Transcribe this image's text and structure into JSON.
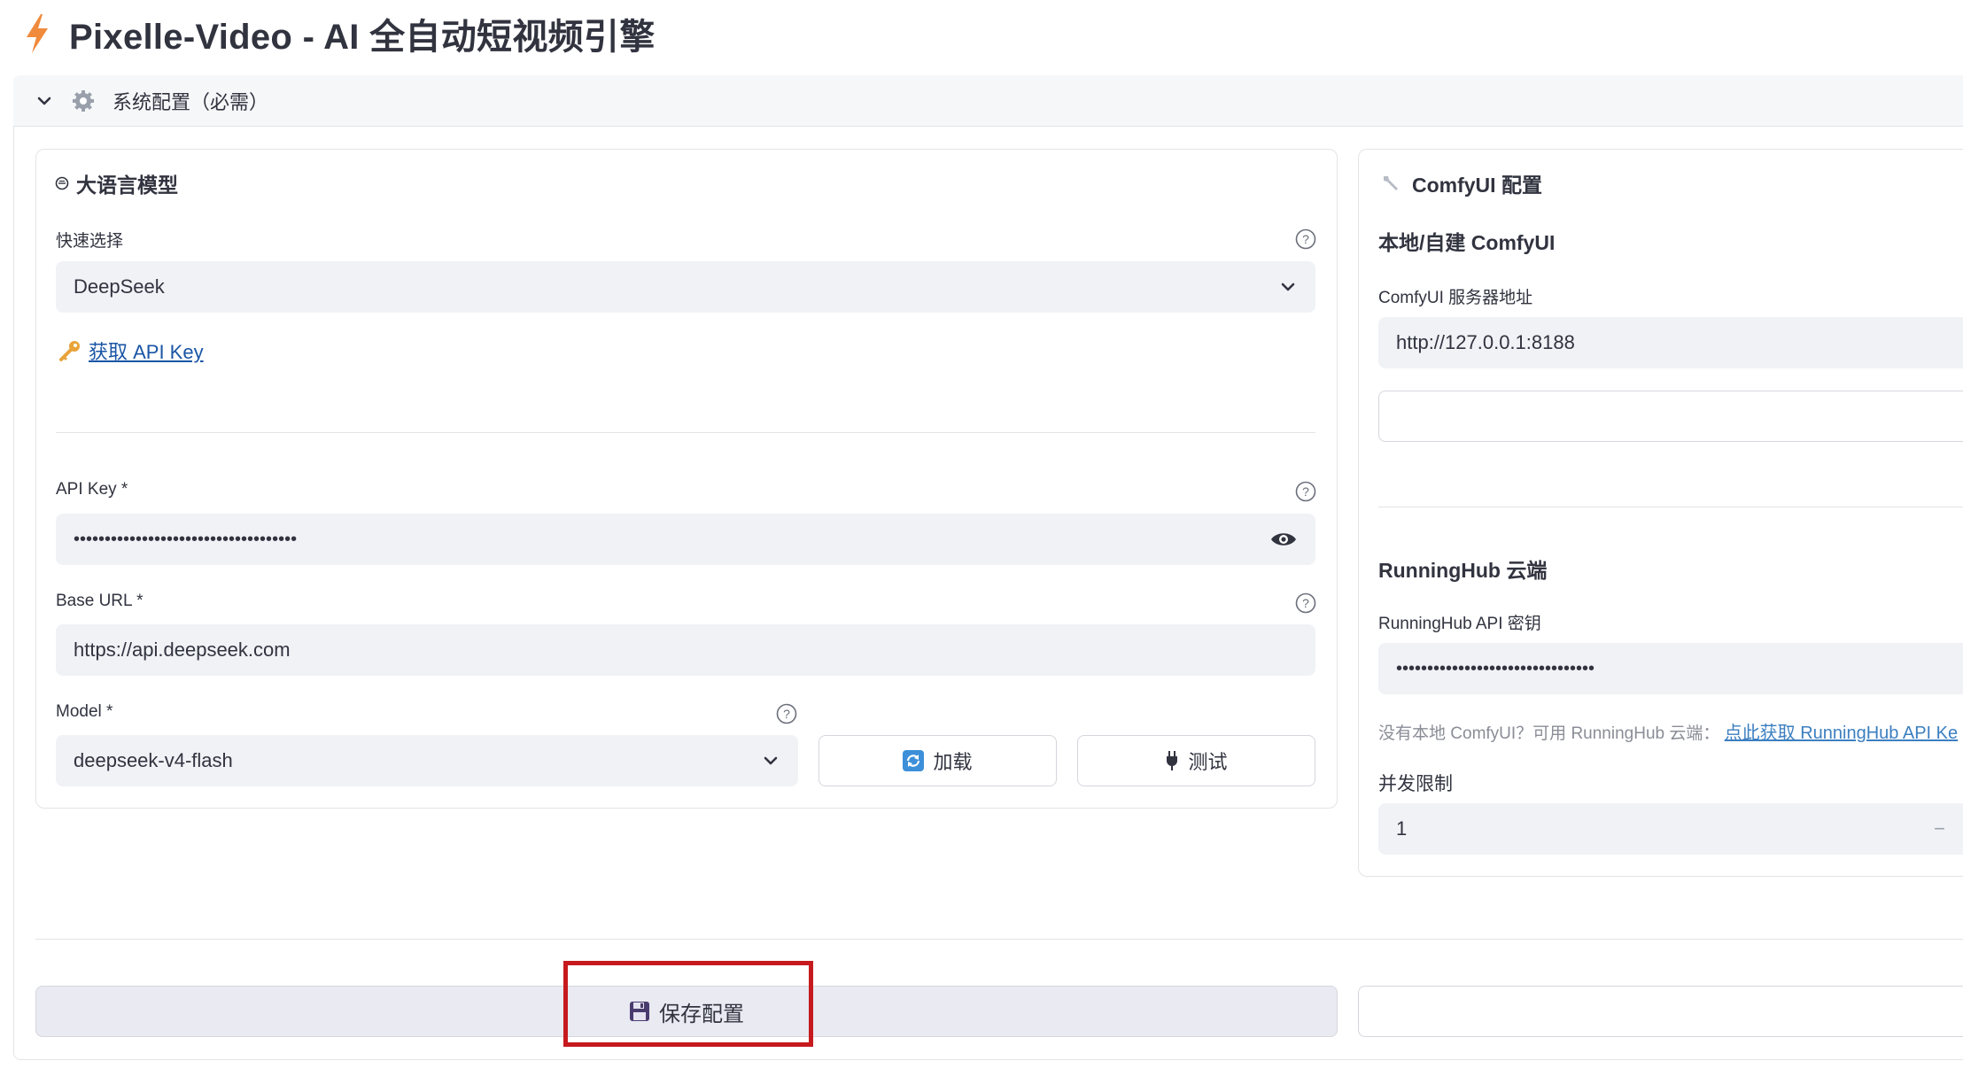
{
  "app": {
    "title": "Pixelle-Video - AI 全自动短视频引擎"
  },
  "expander": {
    "label": "系统配置（必需）"
  },
  "llm": {
    "heading": "大语言模型",
    "quick_select_label": "快速选择",
    "quick_select_value": "DeepSeek",
    "get_key_link": "获取 API Key",
    "api_key_label": "API Key *",
    "api_key_value": "••••••••••••••••••••••••••••••••••••",
    "base_url_label": "Base URL *",
    "base_url_value": "https://api.deepseek.com",
    "model_label": "Model *",
    "model_value": "deepseek-v4-flash",
    "load_button": "加载",
    "test_button": "测试"
  },
  "comfy": {
    "heading": "ComfyUI 配置",
    "local_heading": "本地/自建 ComfyUI",
    "server_label": "ComfyUI 服务器地址",
    "server_value": "http://127.0.0.1:8188",
    "runninghub_heading": "RunningHub 云端",
    "runninghub_key_label": "RunningHub API 密钥",
    "runninghub_key_value": "••••••••••••••••••••••••••••••••",
    "hint_text": "没有本地 ComfyUI？可用 RunningHub 云端：",
    "hint_link": "点此获取 RunningHub API Ke",
    "concurrency_label": "并发限制",
    "concurrency_value": "1",
    "minus": "−"
  },
  "save": {
    "label": "保存配置"
  },
  "colors": {
    "accent": "#1a55a5",
    "highlight": "#c61a1e",
    "bolt": "#f08a3c"
  }
}
